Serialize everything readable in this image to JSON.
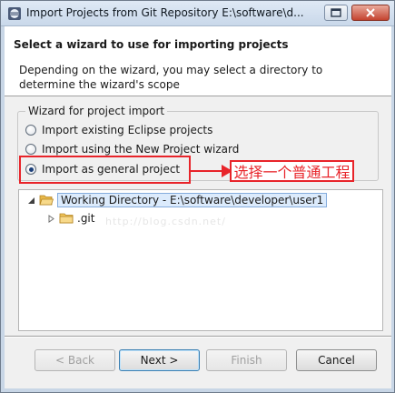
{
  "window": {
    "title": "Import Projects from Git Repository E:\\software\\d..."
  },
  "header": {
    "title": "Select a wizard to use for importing projects",
    "description": "Depending on the wizard, you may select a directory to determine the wizard's scope"
  },
  "wizard_group": {
    "legend": "Wizard for project import",
    "options": [
      {
        "label": "Import existing Eclipse projects",
        "checked": false
      },
      {
        "label": "Import using the New Project wizard",
        "checked": false
      },
      {
        "label": "Import as general project",
        "checked": true
      }
    ]
  },
  "annotation": {
    "text": "选择一个普通工程",
    "color": "#e8242a"
  },
  "tree": {
    "items": [
      {
        "label": "Working Directory - E:\\software\\developer\\user1",
        "expanded": true,
        "selected": true,
        "icon": "open-folder-icon"
      },
      {
        "label": ".git",
        "expanded": false,
        "selected": false,
        "icon": "folder-icon"
      }
    ]
  },
  "watermark": "http://blog.csdn.net/",
  "buttons": {
    "back": "< Back",
    "next": "Next >",
    "finish": "Finish",
    "cancel": "Cancel"
  }
}
